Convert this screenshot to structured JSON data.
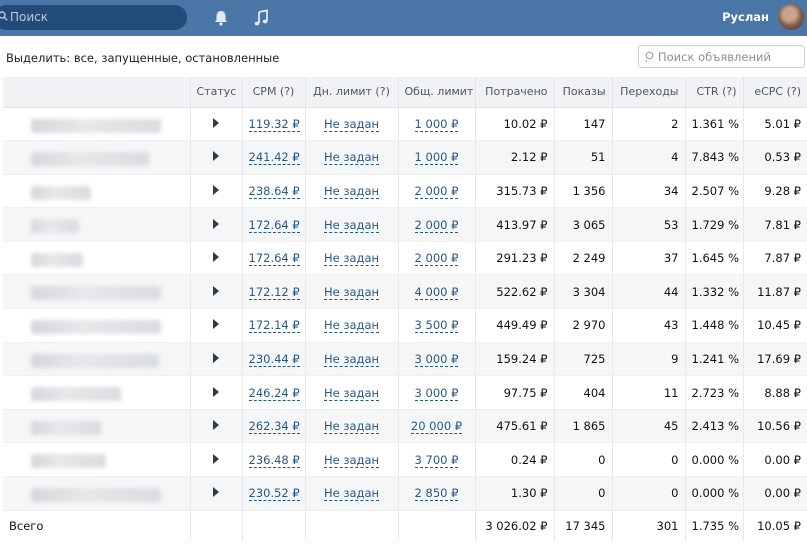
{
  "header": {
    "search_placeholder": "Поиск",
    "user_name": "Руслан"
  },
  "filter": {
    "label": "Выделить:",
    "all": "все,",
    "running": "запущенные,",
    "stopped": "остановленные"
  },
  "ad_search_placeholder": "Поиск объявлений",
  "table": {
    "headers": [
      "",
      "Статус",
      "CPM (?)",
      "Дн. лимит (?)",
      "Общ. лимит",
      "Потрачено",
      "Показы",
      "Переходы",
      "CTR (?)",
      "eCPC (?)"
    ],
    "rows": [
      {
        "cpm": "119.32 ₽",
        "day": "Не задан",
        "total": "1 000 ₽",
        "spent": "10.02 ₽",
        "views": "147",
        "clicks": "2",
        "ctr": "1.361 %",
        "ecpc": "5.01 ₽"
      },
      {
        "cpm": "241.42 ₽",
        "day": "Не задан",
        "total": "1 000 ₽",
        "spent": "2.12 ₽",
        "views": "51",
        "clicks": "4",
        "ctr": "7.843 %",
        "ecpc": "0.53 ₽"
      },
      {
        "cpm": "238.64 ₽",
        "day": "Не задан",
        "total": "2 000 ₽",
        "spent": "315.73 ₽",
        "views": "1 356",
        "clicks": "34",
        "ctr": "2.507 %",
        "ecpc": "9.28 ₽"
      },
      {
        "cpm": "172.64 ₽",
        "day": "Не задан",
        "total": "2 000 ₽",
        "spent": "413.97 ₽",
        "views": "3 065",
        "clicks": "53",
        "ctr": "1.729 %",
        "ecpc": "7.81 ₽"
      },
      {
        "cpm": "172.64 ₽",
        "day": "Не задан",
        "total": "2 000 ₽",
        "spent": "291.23 ₽",
        "views": "2 249",
        "clicks": "37",
        "ctr": "1.645 %",
        "ecpc": "7.87 ₽"
      },
      {
        "cpm": "172.12 ₽",
        "day": "Не задан",
        "total": "4 000 ₽",
        "spent": "522.62 ₽",
        "views": "3 304",
        "clicks": "44",
        "ctr": "1.332 %",
        "ecpc": "11.87 ₽"
      },
      {
        "cpm": "172.14 ₽",
        "day": "Не задан",
        "total": "3 500 ₽",
        "spent": "449.49 ₽",
        "views": "2 970",
        "clicks": "43",
        "ctr": "1.448 %",
        "ecpc": "10.45 ₽"
      },
      {
        "cpm": "230.44 ₽",
        "day": "Не задан",
        "total": "3 000 ₽",
        "spent": "159.24 ₽",
        "views": "725",
        "clicks": "9",
        "ctr": "1.241 %",
        "ecpc": "17.69 ₽"
      },
      {
        "cpm": "246.24 ₽",
        "day": "Не задан",
        "total": "3 000 ₽",
        "spent": "97.75 ₽",
        "views": "404",
        "clicks": "11",
        "ctr": "2.723 %",
        "ecpc": "8.88 ₽"
      },
      {
        "cpm": "262.34 ₽",
        "day": "Не задан",
        "total": "20 000 ₽",
        "spent": "475.61 ₽",
        "views": "1 865",
        "clicks": "45",
        "ctr": "2.413 %",
        "ecpc": "10.56 ₽"
      },
      {
        "cpm": "236.48 ₽",
        "day": "Не задан",
        "total": "3 700 ₽",
        "spent": "0.24 ₽",
        "views": "0",
        "clicks": "0",
        "ctr": "0.000 %",
        "ecpc": "0.00 ₽"
      },
      {
        "cpm": "230.52 ₽",
        "day": "Не задан",
        "total": "2 850 ₽",
        "spent": "1.30 ₽",
        "views": "0",
        "clicks": "0",
        "ctr": "0.000 %",
        "ecpc": "0.00 ₽"
      }
    ],
    "totals": {
      "label": "Всего",
      "spent": "3 026.02 ₽",
      "views": "17 345",
      "clicks": "301",
      "ctr": "1.735 %",
      "ecpc": "10.05 ₽"
    }
  },
  "icons": {
    "search": "search-icon",
    "notifications": "bell-icon",
    "music": "music-icon",
    "play": "play-icon"
  },
  "colors": {
    "header_bg": "#4a76a8",
    "link": "#2a5885"
  }
}
